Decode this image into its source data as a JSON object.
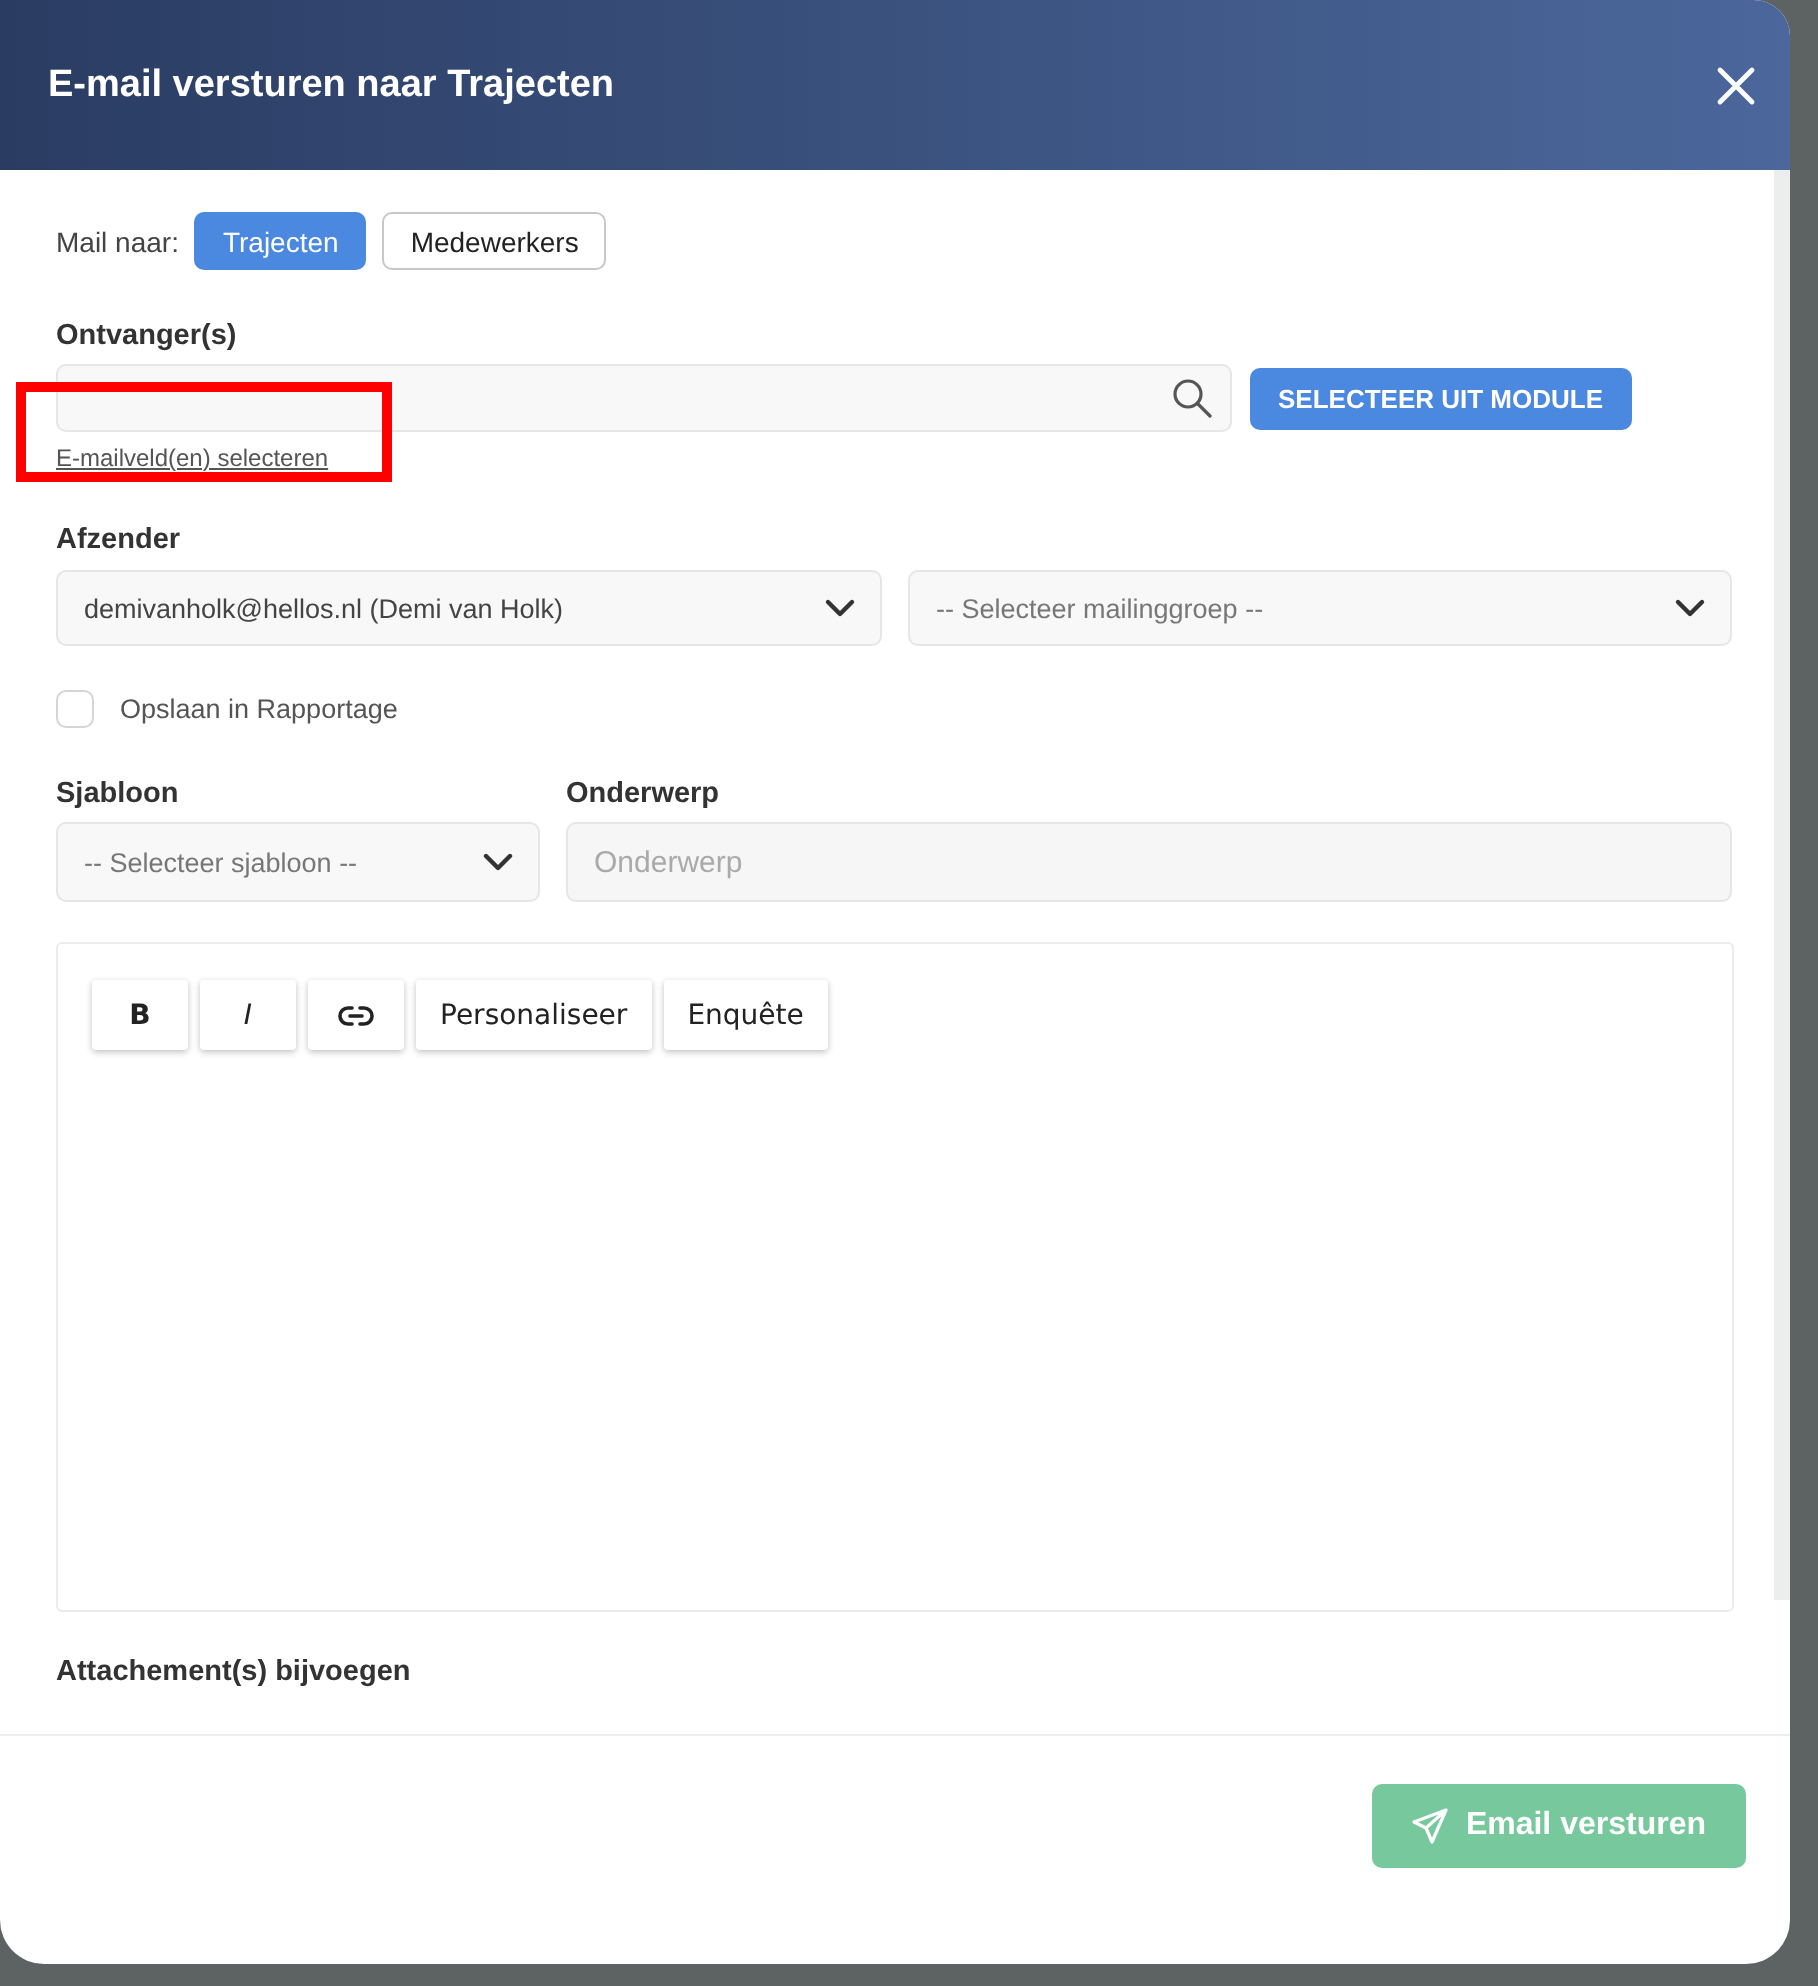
{
  "dialog": {
    "title": "E-mail versturen naar Trajecten"
  },
  "mail_to": {
    "label": "Mail naar:",
    "options": [
      {
        "label": "Trajecten",
        "selected": true
      },
      {
        "label": "Medewerkers",
        "selected": false
      }
    ]
  },
  "recipients": {
    "label": "Ontvanger(s)",
    "select_button": "SELECTEER UIT MODULE",
    "link": "E-mailveld(en) selecteren",
    "link_highlighted": true
  },
  "sender": {
    "label": "Afzender",
    "value": "demivanholk@hellos.nl (Demi van Holk)",
    "group_placeholder": "-- Selecteer mailinggroep --"
  },
  "save_report": {
    "label": "Opslaan in Rapportage",
    "checked": false
  },
  "template": {
    "label": "Sjabloon",
    "placeholder": "-- Selecteer sjabloon --"
  },
  "subject": {
    "label": "Onderwerp",
    "placeholder": "Onderwerp"
  },
  "editor": {
    "toolbar": [
      {
        "kind": "bold",
        "label": "B"
      },
      {
        "kind": "italic",
        "label": "I"
      },
      {
        "kind": "link"
      },
      {
        "kind": "text",
        "label": "Personaliseer"
      },
      {
        "kind": "text",
        "label": "Enquête"
      }
    ]
  },
  "attachments": {
    "label": "Attachement(s) bijvoegen"
  },
  "footer": {
    "send_button": "Email versturen"
  }
}
